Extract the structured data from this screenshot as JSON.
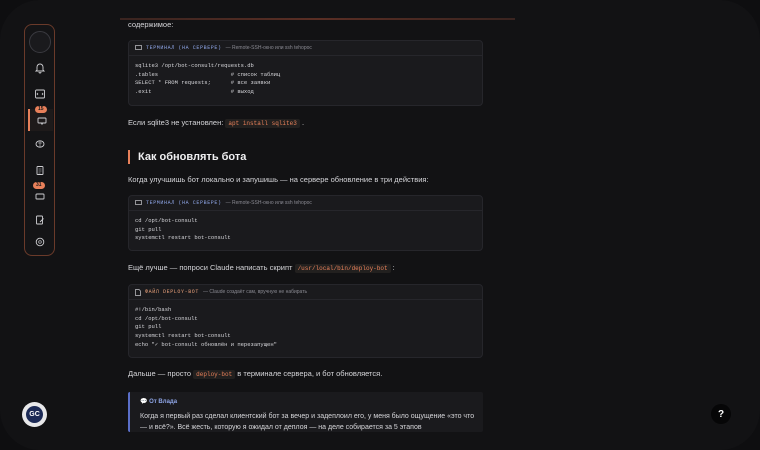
{
  "intro_text": "содержимое:",
  "block1": {
    "tag": "ТЕРМИНАЛ (НА СЕРВЕРЕ)",
    "desc": "— Remote-SSH-окно или ssh tehopoc",
    "lines": [
      "sqlite3 /opt/bot-consult/requests.db",
      ".tables                      # список таблиц",
      "SELECT * FROM requests;      # все заявки",
      ".exit                        # выход"
    ]
  },
  "sqlite_note": {
    "prefix": "Если sqlite3 не установлен:",
    "code": "apt install sqlite3",
    "suffix": "."
  },
  "heading": "Как обновлять бота",
  "update_text": "Когда улучшишь бот локально и запушишь — на сервере обновление в три действия:",
  "block2": {
    "tag": "ТЕРМИНАЛ (НА СЕРВЕРЕ)",
    "desc": "— Remote-SSH-окно или ssh tehopoc",
    "lines": [
      "cd /opt/bot-consult",
      "git pull",
      "systemctl restart bot-consult"
    ]
  },
  "better_note": {
    "prefix": "Ещё лучше — попроси Claude написать скрипт",
    "code": "/usr/local/bin/deploy-bot",
    "suffix": ":"
  },
  "block3": {
    "tag": "ФАЙЛ DEPLOY-BOT",
    "desc": "— Claude создаёт сам, вручную не набирать",
    "lines": [
      "#!/bin/bash",
      "cd /opt/bot-consult",
      "git pull",
      "systemctl restart bot-consult",
      "echo \"✓ bot-consult обновлён и перезапущен\""
    ]
  },
  "then_note": {
    "prefix": "Дальше — просто",
    "code": "deploy-bot",
    "suffix": "в терминале сервера, и бот обновляется."
  },
  "quote": {
    "author": "От Влада",
    "text": "Когда я первый раз сделал клиентский бот за вечер и задеплоил его, у меня было ощущение «это что — и всё?». Всё жесть, которую я ожидал от деплоя — на деле собирается за 5 этапов"
  },
  "sidebar": {
    "badges": [
      "15",
      "31"
    ]
  },
  "logo_text": "GC",
  "help_label": "?"
}
